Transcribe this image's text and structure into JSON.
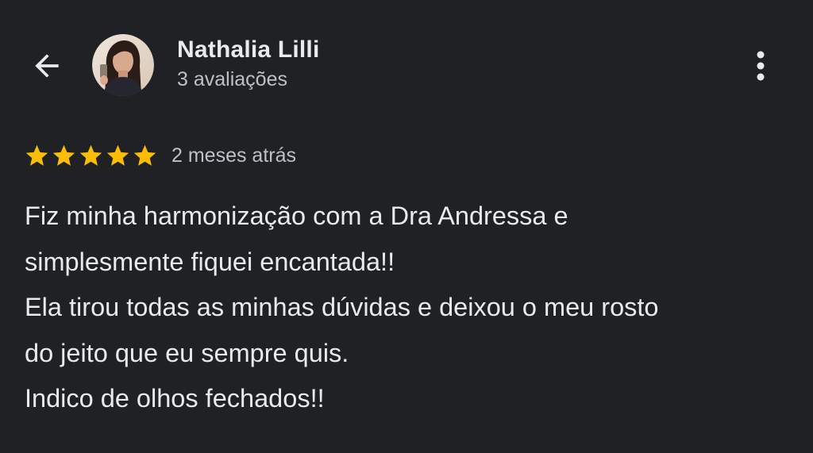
{
  "header": {
    "back_icon": "arrow-back-icon",
    "more_icon": "more-vertical-icon",
    "reviewer": {
      "name": "Nathalia Lilli",
      "review_count": "3 avaliações",
      "avatar": "profile-photo"
    }
  },
  "review": {
    "rating": 5,
    "rating_max": 5,
    "star_color": "#fbbc04",
    "date": "2 meses atrás",
    "text_lines": [
      "Fiz minha harmonização com a Dra Andressa e",
      "simplesmente fiquei encantada!!",
      "Ela tirou todas as minhas dúvidas e deixou o meu rosto",
      "do jeito que eu sempre quis.",
      "Indico de olhos fechados!!"
    ]
  },
  "theme": {
    "background": "#202124",
    "text_primary": "#e8eaed",
    "text_secondary": "#bdc1c6"
  }
}
